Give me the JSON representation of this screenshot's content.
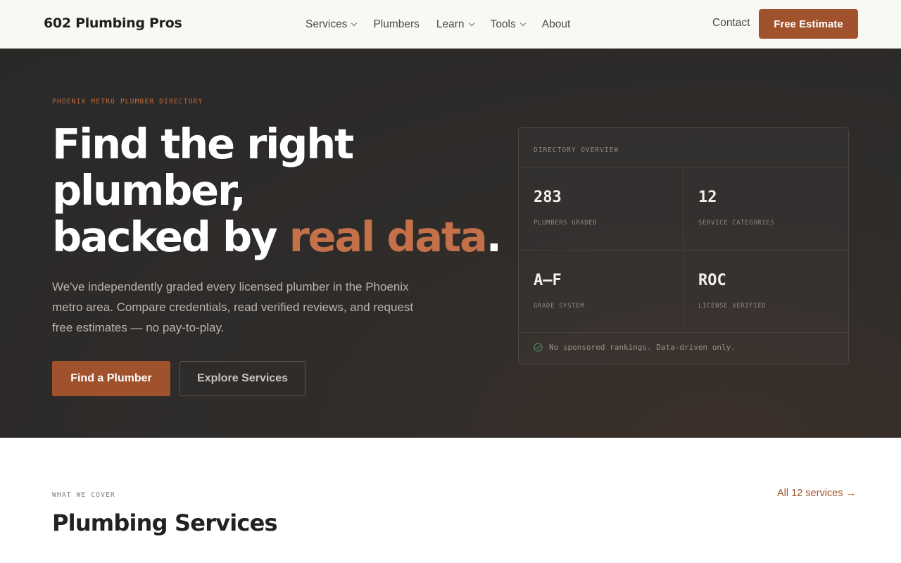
{
  "nav": {
    "brand": "602 Plumbing Pros",
    "items": [
      {
        "label": "Services",
        "dropdown": true
      },
      {
        "label": "Plumbers",
        "dropdown": false
      },
      {
        "label": "Learn",
        "dropdown": true
      },
      {
        "label": "Tools",
        "dropdown": true
      },
      {
        "label": "About",
        "dropdown": false
      }
    ],
    "contact": "Contact",
    "cta": "Free Estimate"
  },
  "hero": {
    "eyebrow": "PHOENIX METRO PLUMBER DIRECTORY",
    "headline_line1": "Find the right",
    "headline_line2": "plumber,",
    "headline_line3_prefix": "backed by ",
    "headline_accent": "real data",
    "headline_period": ".",
    "subtext": "We've independently graded every licensed plumber in the Phoenix metro area. Compare credentials, read verified reviews, and request free estimates — no pay-to-play.",
    "primary_button": "Find a Plumber",
    "secondary_button": "Explore Services"
  },
  "overview": {
    "title": "DIRECTORY OVERVIEW",
    "stats": [
      {
        "value": "283",
        "label": "PLUMBERS GRADED"
      },
      {
        "value": "12",
        "label": "SERVICE CATEGORIES"
      },
      {
        "value": "A–F",
        "label": "GRADE SYSTEM"
      },
      {
        "value": "ROC",
        "label": "LICENSE VERIFIED"
      }
    ],
    "footer": "No sponsored rankings. Data-driven only."
  },
  "services": {
    "eyebrow": "WHAT WE COVER",
    "title": "Plumbing Services",
    "link": "All 12 services →"
  },
  "colors": {
    "accent": "#a0522d",
    "accent_text": "#c4714a",
    "hero_bg": "#2e2c2a",
    "check": "#4c8a5e"
  }
}
